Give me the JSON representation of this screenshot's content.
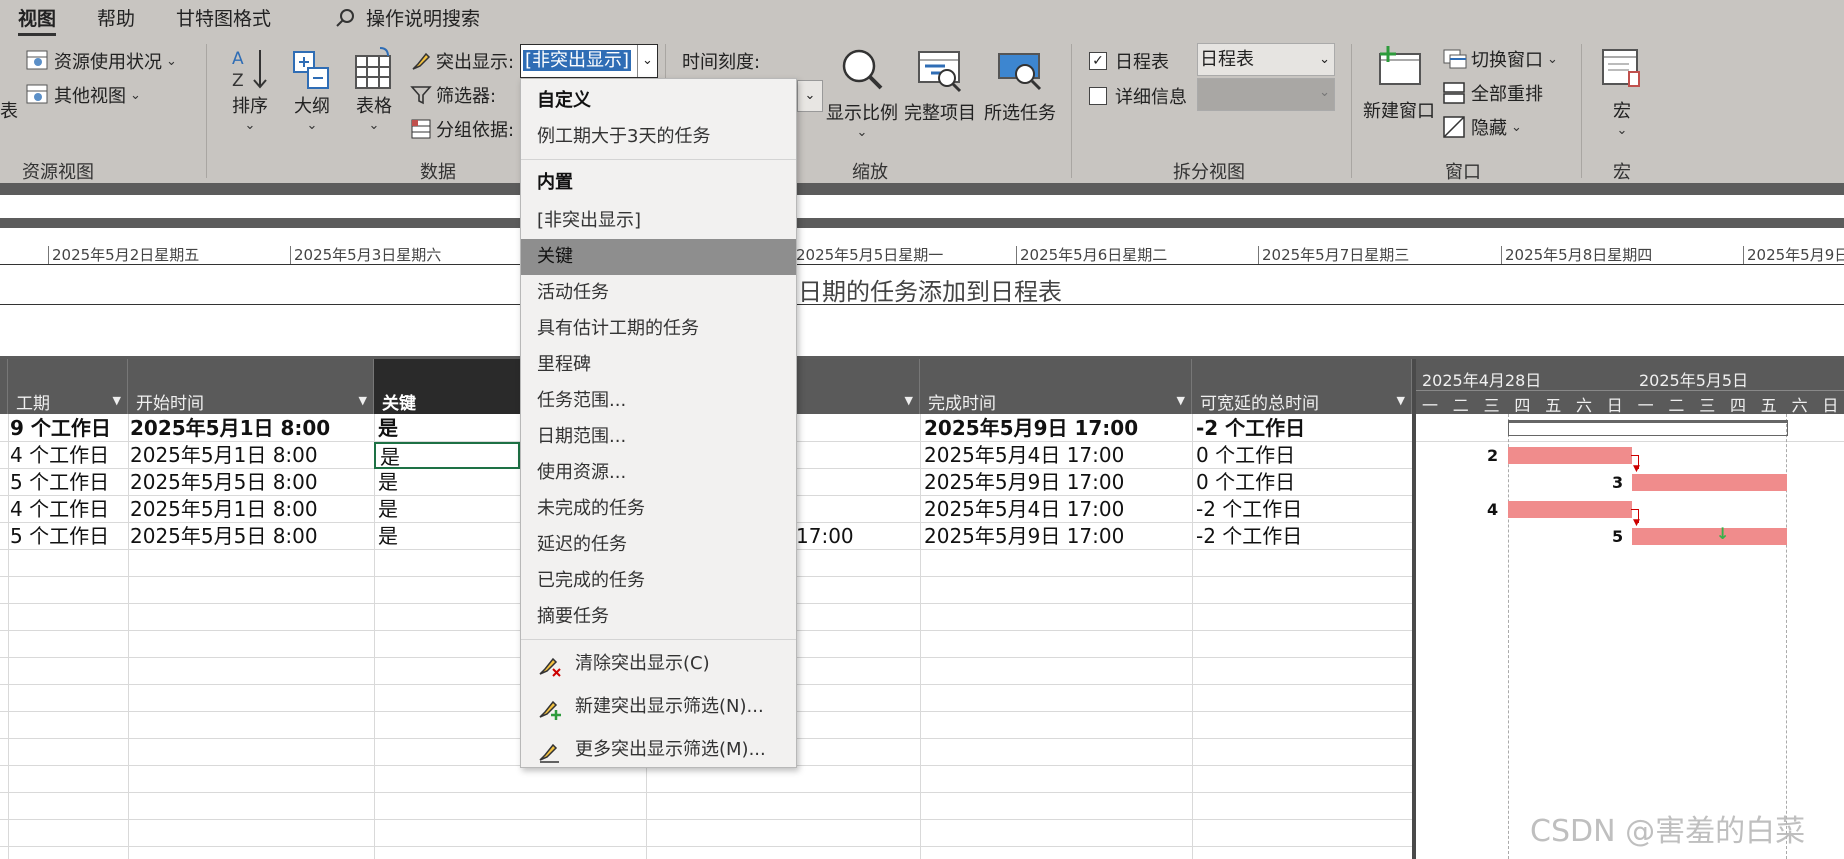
{
  "tabs": {
    "view": "视图",
    "help": "帮助",
    "gantt_format": "甘特图格式",
    "search": "操作说明搜索"
  },
  "resource_view": {
    "resource_usage": "资源使用状况",
    "other_views": "其他视图",
    "left_cut": "表",
    "group": "资源视图"
  },
  "data_group": {
    "sort": "排序",
    "outline": "大纲",
    "tables": "表格",
    "highlight_label": "突出显示:",
    "highlight_value": "[非突出显示]",
    "filter_label": "筛选器:",
    "group_by_label": "分组依据:",
    "group": "数据"
  },
  "zoom_group": {
    "timescale": "时间刻度:",
    "zoom": "显示比例",
    "entire_project": "完整项目",
    "selected_tasks": "所选任务",
    "group": "缩放"
  },
  "split_group": {
    "timeline": "日程表",
    "details": "详细信息",
    "timeline_select": "日程表",
    "group": "拆分视图"
  },
  "window_group": {
    "new_window": "新建窗口",
    "switch_window": "切换窗口",
    "arrange_all": "全部重排",
    "hide": "隐藏",
    "group": "窗口"
  },
  "macros_group": {
    "macros": "宏",
    "group": "宏"
  },
  "timeline": {
    "ticks": [
      "2025年5月2日星期五",
      "2025年5月3日星期六",
      "2025年5月5日星期一",
      "2025年5月6日星期二",
      "2025年5月7日星期三",
      "2025年5月8日星期四",
      "2025年5月9日"
    ],
    "placeholder": "日期的任务添加到日程表"
  },
  "table": {
    "headers": {
      "duration": "工期",
      "start": "开始时间",
      "critical": "关键",
      "finish": "完成时间",
      "slack": "可宽延的总时间"
    },
    "rows": [
      {
        "duration": "9 个工作日",
        "start": "2025年5月1日 8:00",
        "critical": "是",
        "mid": "",
        "finish": "2025年5月9日 17:00",
        "slack": "-2 个工作日"
      },
      {
        "duration": "4 个工作日",
        "start": "2025年5月1日 8:00",
        "critical": "是",
        "mid": "",
        "finish": "2025年5月4日 17:00",
        "slack": "0 个工作日"
      },
      {
        "duration": "5 个工作日",
        "start": "2025年5月5日 8:00",
        "critical": "是",
        "mid": "",
        "finish": "2025年5月9日 17:00",
        "slack": "0 个工作日"
      },
      {
        "duration": "4 个工作日",
        "start": "2025年5月1日 8:00",
        "critical": "是",
        "mid": "",
        "finish": "2025年5月4日 17:00",
        "slack": "-2 个工作日"
      },
      {
        "duration": "5 个工作日",
        "start": "2025年5月5日 8:00",
        "critical": "是",
        "mid": "17:00",
        "finish": "2025年5月9日 17:00",
        "slack": "-2 个工作日"
      }
    ]
  },
  "gantt": {
    "week1": "2025年4月28日",
    "week2": "2025年5月5日",
    "days": [
      "一",
      "二",
      "三",
      "四",
      "五",
      "六",
      "日",
      "一",
      "二",
      "三",
      "四",
      "五",
      "六",
      "日"
    ],
    "labels": [
      "2",
      "3",
      "4",
      "5"
    ]
  },
  "menu": {
    "custom_header": "自定义",
    "custom_item": "例工期大于3天的任务",
    "builtin_header": "内置",
    "items": [
      "[非突出显示]",
      "关键",
      "活动任务",
      "具有估计工期的任务",
      "里程碑",
      "任务范围...",
      "日期范围...",
      "使用资源...",
      "未完成的任务",
      "延迟的任务",
      "已完成的任务",
      "摘要任务"
    ],
    "clear": "清除突出显示(C)",
    "new_filter": "新建突出显示筛选(N)...",
    "more_filters": "更多突出显示筛选(M)..."
  },
  "watermark": "CSDN @害羞的白菜",
  "colors": {
    "ribbon": "#c8c5c1",
    "header": "#5a5a5a",
    "critical_bar": "#f08c8c",
    "menu_selected": "#8e8e8e"
  }
}
